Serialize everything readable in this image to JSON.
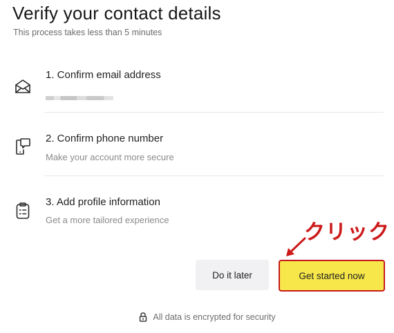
{
  "header": {
    "title": "Verify your contact details",
    "subtitle": "This process takes less than 5 minutes"
  },
  "steps": [
    {
      "title": "1. Confirm email address",
      "description": "",
      "icon": "envelope-icon",
      "masked_value": true
    },
    {
      "title": "2. Confirm phone number",
      "description": "Make your account more secure",
      "icon": "phone-chat-icon"
    },
    {
      "title": "3. Add profile information",
      "description": "Get a more tailored experience",
      "icon": "clipboard-icon"
    }
  ],
  "actions": {
    "later_label": "Do it later",
    "start_label": "Get started now"
  },
  "annotation": {
    "text": "クリック",
    "color": "#cc1a1a"
  },
  "footer": {
    "text": "All data is encrypted for security",
    "icon": "lock-icon"
  },
  "colors": {
    "primary_button": "#f7e74a",
    "highlight_border": "#c7181b",
    "secondary_button": "#f1f1f3"
  }
}
